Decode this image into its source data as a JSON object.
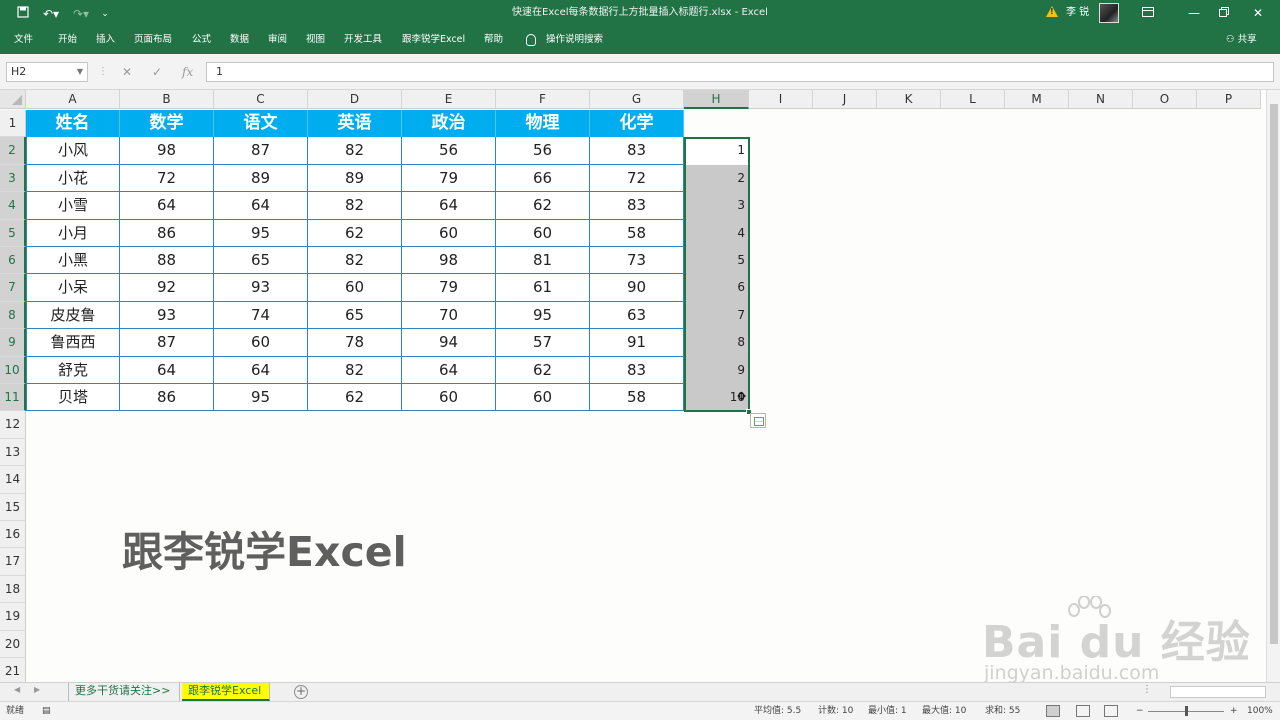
{
  "titlebar": {
    "title": "快速在Excel每条数据行上方批量插入标题行.xlsx  -  Excel",
    "user": "李 锐",
    "warning_icon": "warning-triangle-icon",
    "quick_access": [
      "save-icon",
      "undo-icon",
      "redo-icon",
      "customize-icon"
    ],
    "window_buttons": [
      "ribbon-display-icon",
      "minimize-icon",
      "restore-icon",
      "close-icon"
    ]
  },
  "ribbon": {
    "tabs": [
      "文件",
      "开始",
      "插入",
      "页面布局",
      "公式",
      "数据",
      "审阅",
      "视图",
      "开发工具",
      "跟李锐学Excel",
      "帮助"
    ],
    "tell_me": "操作说明搜索",
    "share": "共享"
  },
  "formula_bar": {
    "name_box": "H2",
    "formula": "1"
  },
  "grid": {
    "columns": [
      "A",
      "B",
      "C",
      "D",
      "E",
      "F",
      "G",
      "H",
      "I",
      "J",
      "K",
      "L",
      "M",
      "N",
      "O",
      "P"
    ],
    "rows": [
      "1",
      "2",
      "3",
      "4",
      "5",
      "6",
      "7",
      "8",
      "9",
      "10",
      "11",
      "12",
      "13",
      "14",
      "15",
      "16",
      "17",
      "18",
      "19",
      "20",
      "21"
    ],
    "selected_column": "H",
    "table_header": [
      "姓名",
      "数学",
      "语文",
      "英语",
      "政治",
      "物理",
      "化学"
    ],
    "table_rows": [
      [
        "小风",
        "98",
        "87",
        "82",
        "56",
        "56",
        "83"
      ],
      [
        "小花",
        "72",
        "89",
        "89",
        "79",
        "66",
        "72"
      ],
      [
        "小雪",
        "64",
        "64",
        "82",
        "64",
        "62",
        "83"
      ],
      [
        "小月",
        "86",
        "95",
        "62",
        "60",
        "60",
        "58"
      ],
      [
        "小黑",
        "88",
        "65",
        "82",
        "98",
        "81",
        "73"
      ],
      [
        "小呆",
        "92",
        "93",
        "60",
        "79",
        "61",
        "90"
      ],
      [
        "皮皮鲁",
        "93",
        "74",
        "65",
        "70",
        "95",
        "63"
      ],
      [
        "鲁西西",
        "87",
        "60",
        "78",
        "94",
        "57",
        "91"
      ],
      [
        "舒克",
        "64",
        "64",
        "82",
        "64",
        "62",
        "83"
      ],
      [
        "贝塔",
        "86",
        "95",
        "62",
        "60",
        "60",
        "58"
      ]
    ],
    "column_h_values": [
      "1",
      "2",
      "3",
      "4",
      "5",
      "6",
      "7",
      "8",
      "9",
      "10"
    ],
    "overlay_title": "跟李锐学Excel"
  },
  "watermark": {
    "brand": "Bai du 经验",
    "url": "jingyan.baidu.com"
  },
  "sheets": {
    "tabs": [
      "更多干货请关注>>",
      "跟李锐学Excel"
    ],
    "active_index": 1
  },
  "status": {
    "mode": "就绪",
    "average": "平均值: 5.5",
    "count": "计数: 10",
    "min": "最小值: 1",
    "max": "最大值: 10",
    "sum": "求和: 55",
    "zoom": "100%"
  },
  "colors": {
    "excel_green": "#217346",
    "header_fill": "#00adee",
    "table_border": "#2e86c1",
    "active_sheet_tab": "#ffff00"
  }
}
